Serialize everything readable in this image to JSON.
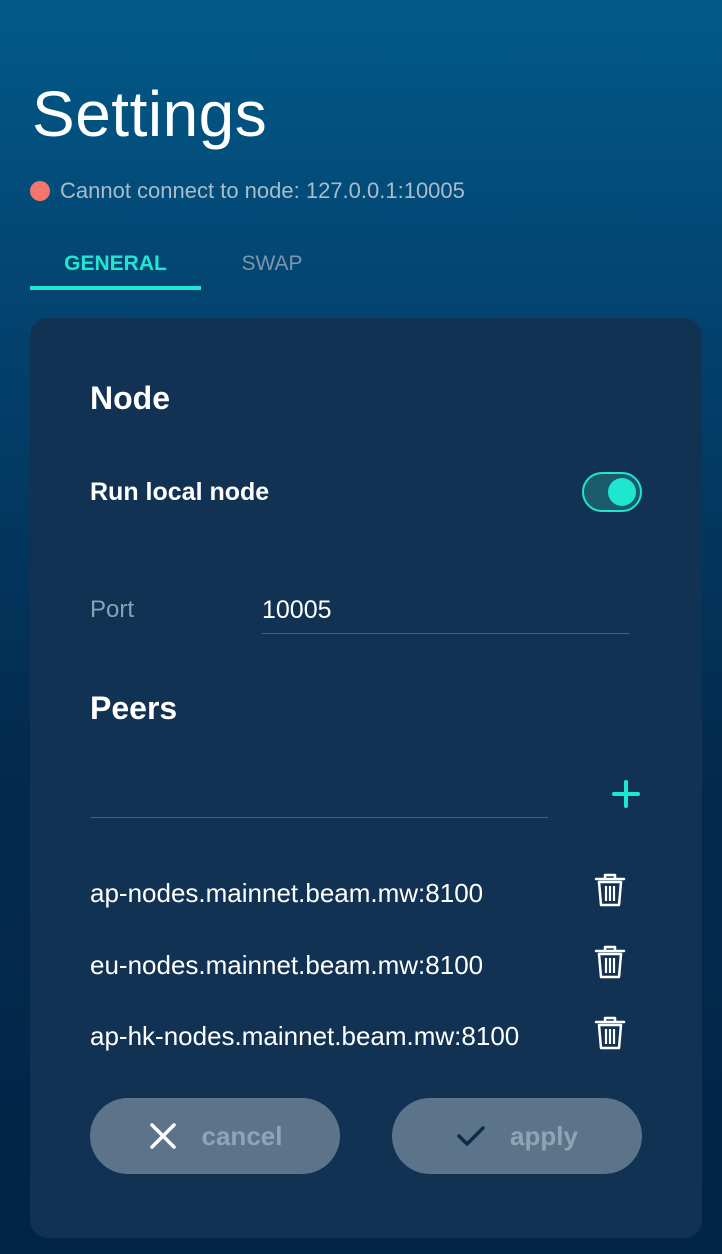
{
  "header": {
    "title": "Settings",
    "status_text": "Cannot connect to node: 127.0.0.1:10005",
    "status_color": "#f4766a"
  },
  "tabs": [
    {
      "label": "GENERAL",
      "active": true
    },
    {
      "label": "SWAP",
      "active": false
    }
  ],
  "node_section": {
    "title": "Node",
    "run_local_node_label": "Run local node",
    "run_local_node_enabled": true,
    "port_label": "Port",
    "port_value": "10005"
  },
  "peers_section": {
    "title": "Peers",
    "new_peer_value": "",
    "add_icon": "plus-icon",
    "items": [
      {
        "address": "ap-nodes.mainnet.beam.mw:8100",
        "icon": "trash-icon"
      },
      {
        "address": "eu-nodes.mainnet.beam.mw:8100",
        "icon": "trash-icon"
      },
      {
        "address": "ap-hk-nodes.mainnet.beam.mw:8100",
        "icon": "trash-icon"
      }
    ]
  },
  "actions": {
    "cancel_label": "cancel",
    "cancel_icon": "close-icon",
    "apply_label": "apply",
    "apply_icon": "check-icon"
  },
  "colors": {
    "accent": "#1ee6cf",
    "card_bg": "#113253",
    "button_bg": "#5b7489"
  }
}
